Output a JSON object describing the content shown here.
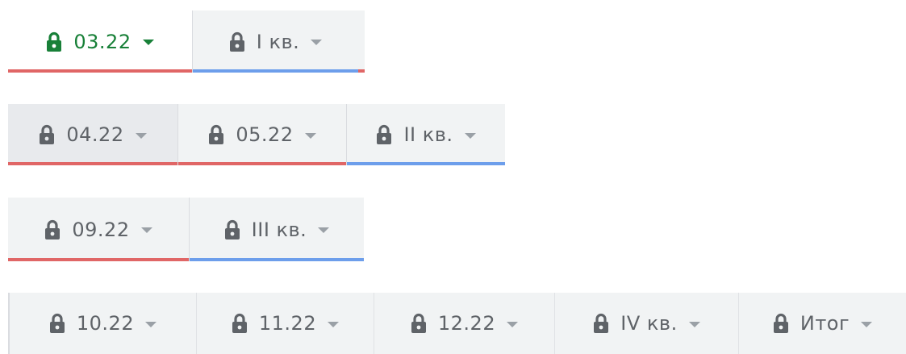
{
  "colors": {
    "monthly_bar": "#e06666",
    "quarter_bar": "#6d9eeb",
    "active_text": "#188038",
    "tab_text": "#5f6368"
  },
  "icons": {
    "tab_icon": "lock-icon",
    "tab_menu": "dropdown-arrow-icon"
  },
  "rows": [
    {
      "tabs": [
        {
          "label": "03.22",
          "state": "active",
          "bar": "monthly"
        },
        {
          "label": "I кв.",
          "state": "normal",
          "bar": "quarter"
        }
      ]
    },
    {
      "tabs": [
        {
          "label": "04.22",
          "state": "pressed",
          "bar": "monthly"
        },
        {
          "label": "05.22",
          "state": "normal",
          "bar": "monthly"
        },
        {
          "label": "II кв.",
          "state": "normal",
          "bar": "quarter"
        }
      ]
    },
    {
      "tabs": [
        {
          "label": "09.22",
          "state": "normal",
          "bar": "monthly"
        },
        {
          "label": "III кв.",
          "state": "normal",
          "bar": "quarter"
        }
      ]
    },
    {
      "tabs": [
        {
          "label": "10.22",
          "state": "normal",
          "bar": "none"
        },
        {
          "label": "11.22",
          "state": "normal",
          "bar": "none"
        },
        {
          "label": "12.22",
          "state": "normal",
          "bar": "none"
        },
        {
          "label": "IV кв.",
          "state": "normal",
          "bar": "none"
        },
        {
          "label": "Итог",
          "state": "normal",
          "bar": "none"
        }
      ]
    }
  ]
}
